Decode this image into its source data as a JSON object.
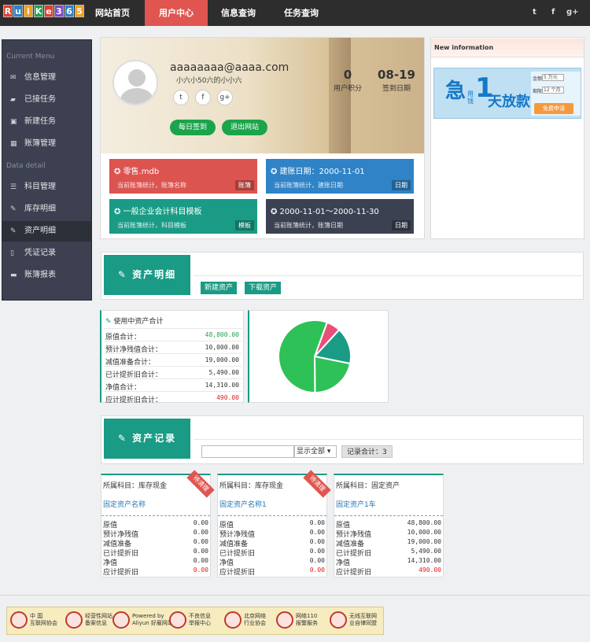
{
  "nav": {
    "logo": "RuiKe365",
    "items": [
      "网站首页",
      "用户中心",
      "信息查询",
      "任务查询"
    ],
    "active": "用户中心",
    "social": [
      "t",
      "f",
      "g+"
    ]
  },
  "sidebar": {
    "section1": "Current Menu",
    "section2": "Data detail",
    "items": [
      {
        "label": "信息管理",
        "icon": "envelope-icon",
        "glyph": "✉"
      },
      {
        "label": "已接任务",
        "icon": "folder-open-icon",
        "glyph": "▰"
      },
      {
        "label": "新建任务",
        "icon": "briefcase-icon",
        "glyph": "▣"
      },
      {
        "label": "账簿管理",
        "icon": "grid-icon",
        "glyph": "▦"
      },
      {
        "label": "科目管理",
        "icon": "list-icon",
        "glyph": "☰"
      },
      {
        "label": "库存明细",
        "icon": "edit-icon",
        "glyph": "✎"
      },
      {
        "label": "资产明细",
        "icon": "edit-icon",
        "glyph": "✎"
      },
      {
        "label": "凭证记录",
        "icon": "file-icon",
        "glyph": "▯"
      },
      {
        "label": "账簿报表",
        "icon": "suitcase-icon",
        "glyph": "▬"
      }
    ],
    "active": "资产明细"
  },
  "profile": {
    "email": "aaaaaaaa@aaaa.com",
    "motto": "小六小50六的小小六",
    "social": [
      "t",
      "f",
      "g+"
    ],
    "checkin_label": "每日签到",
    "logout_label": "退出网站",
    "points_value": "0",
    "points_label": "用户积分",
    "date_value": "08-19",
    "date_label": "签到日期"
  },
  "tiles": [
    {
      "title": "✪ 零售.mdb",
      "sub": "当前账簿统计，账簿名称",
      "tag": "账簿",
      "color": "#dc5450"
    },
    {
      "title": "✪ 建账日期：2000-11-01",
      "sub": "当前账簿统计，建账日期",
      "tag": "日期",
      "color": "#2f83c6"
    },
    {
      "title": "✪ 一般企业会计科目模板",
      "sub": "当前账簿统计，科目模板",
      "tag": "模板",
      "color": "#1a9b85"
    },
    {
      "title": "✪ 2000-11-01～2000-11-30",
      "sub": "当前账簿统计，账簿日期",
      "tag": "日期",
      "color": "#3c4152"
    }
  ],
  "news": {
    "title": "New information",
    "ad": {
      "char1": "急",
      "char2": "用钱",
      "num": "1",
      "text": "天放款",
      "label_amount": "金额",
      "amount": "5 万元",
      "label_term": "期限",
      "term": "12 个月",
      "button": "免费申请"
    }
  },
  "asset_section": {
    "title": "资产明细",
    "new_label": "新建资产",
    "download_label": "下载资产"
  },
  "summary": {
    "title": "使用中资产合计",
    "rows": [
      {
        "label": "原值合计：",
        "value": "48,800.00",
        "tone": "green"
      },
      {
        "label": "预计净残值合计：",
        "value": "10,000.00",
        "tone": ""
      },
      {
        "label": "减值准备合计：",
        "value": "19,000.00",
        "tone": ""
      },
      {
        "label": "已计提折旧合计：",
        "value": "5,490.00",
        "tone": ""
      },
      {
        "label": "净值合计：",
        "value": "14,310.00",
        "tone": ""
      },
      {
        "label": "应计提折旧合计：",
        "value": "490.00",
        "tone": "red"
      }
    ]
  },
  "chart_data": {
    "type": "pie",
    "slices": [
      {
        "value": 48800,
        "color": "#2ec157"
      },
      {
        "value": 19000,
        "color": "#2ec157"
      },
      {
        "value": 14310,
        "color": "#1a9b85"
      },
      {
        "value": 5490,
        "color": "#e8507a"
      }
    ]
  },
  "records": {
    "title": "资产记录",
    "select_value": "显示全部",
    "count_label": "记录合计：3",
    "cards": [
      {
        "subject": "所属科目：库存现金",
        "name": "固定资产名称",
        "ribbon": "待清理",
        "rows": [
          [
            "原值",
            "0.00",
            ""
          ],
          [
            "预计净残值",
            "0.00",
            ""
          ],
          [
            "减值准备",
            "0.00",
            ""
          ],
          [
            "已计提折旧",
            "0.00",
            ""
          ],
          [
            "净值",
            "0.00",
            ""
          ],
          [
            "应计提折旧",
            "0.00",
            "red"
          ]
        ]
      },
      {
        "subject": "所属科目：库存现金",
        "name": "固定资产名称1",
        "ribbon": "待清理",
        "rows": [
          [
            "原值",
            "0.00",
            ""
          ],
          [
            "预计净残值",
            "0.00",
            ""
          ],
          [
            "减值准备",
            "0.00",
            ""
          ],
          [
            "已计提折旧",
            "0.00",
            ""
          ],
          [
            "净值",
            "0.00",
            ""
          ],
          [
            "应计提折旧",
            "0.00",
            "red"
          ]
        ]
      },
      {
        "subject": "所属科目：固定资产",
        "name": "固定资产1车",
        "ribbon": "",
        "rows": [
          [
            "原值",
            "48,800.00",
            ""
          ],
          [
            "预计净残值",
            "10,000.00",
            ""
          ],
          [
            "减值准备",
            "19,000.00",
            ""
          ],
          [
            "已计提折旧",
            "5,490.00",
            ""
          ],
          [
            "净值",
            "14,310.00",
            ""
          ],
          [
            "应计提折旧",
            "490.00",
            "red"
          ]
        ]
      }
    ]
  },
  "footer": {
    "badges": [
      "中 国\n互联网协会",
      "经营性网站\n备案信息",
      "Powered by\nAliyun 好雇网站",
      "不良信息\n举报中心",
      "北京网络\n行业协会",
      "网络110\n报警服务",
      "无线互联网\n业自律同盟"
    ]
  }
}
